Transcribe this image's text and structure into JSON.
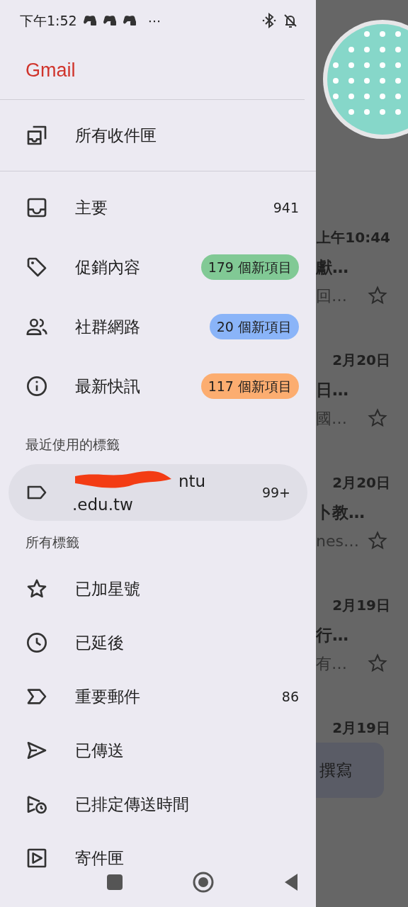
{
  "status_bar": {
    "time": "下午1:52",
    "more": "⋯"
  },
  "app_title": "Gmail",
  "all_inboxes": {
    "label": "所有收件匣",
    "selected": false
  },
  "categories": [
    {
      "label": "主要",
      "kind": "count",
      "count": "941",
      "selected": false
    },
    {
      "label": "促銷內容",
      "kind": "badge",
      "count": "179 個新項目",
      "color": "#81c995",
      "selected": false
    },
    {
      "label": "社群網路",
      "kind": "badge",
      "count": "20 個新項目",
      "color": "#8ab4f8",
      "selected": false
    },
    {
      "label": "最新快訊",
      "kind": "badge",
      "count": "117 個新項目",
      "color": "#fcad70",
      "selected": false
    }
  ],
  "recent_labels": {
    "heading": "最近使用的標籤",
    "items": [
      {
        "label_lines": [
          "ntu",
          ".edu.tw"
        ],
        "redacted": true,
        "count": "99+",
        "selected": true
      }
    ]
  },
  "all_labels": {
    "heading": "所有標籤",
    "items": [
      {
        "label": "已加星號",
        "selected": false
      },
      {
        "label": "已延後",
        "selected": false
      },
      {
        "label": "重要郵件",
        "count": "86",
        "selected": false
      },
      {
        "label": "已傳送",
        "selected": false
      },
      {
        "label": "已排定傳送時間",
        "selected": false
      },
      {
        "label": "寄件匣",
        "selected": false
      }
    ]
  },
  "background_list": [
    {
      "time": "上午10:44",
      "subject": "獻…",
      "snippet": "回…"
    },
    {
      "time": "2月20日",
      "subject": "日…",
      "snippet": "國…"
    },
    {
      "time": "2月20日",
      "subject": "卜教…",
      "snippet": "nes…"
    },
    {
      "time": "2月19日",
      "subject": "行…",
      "snippet": "有…"
    },
    {
      "time": "2月19日"
    }
  ],
  "compose_button": "撰寫"
}
